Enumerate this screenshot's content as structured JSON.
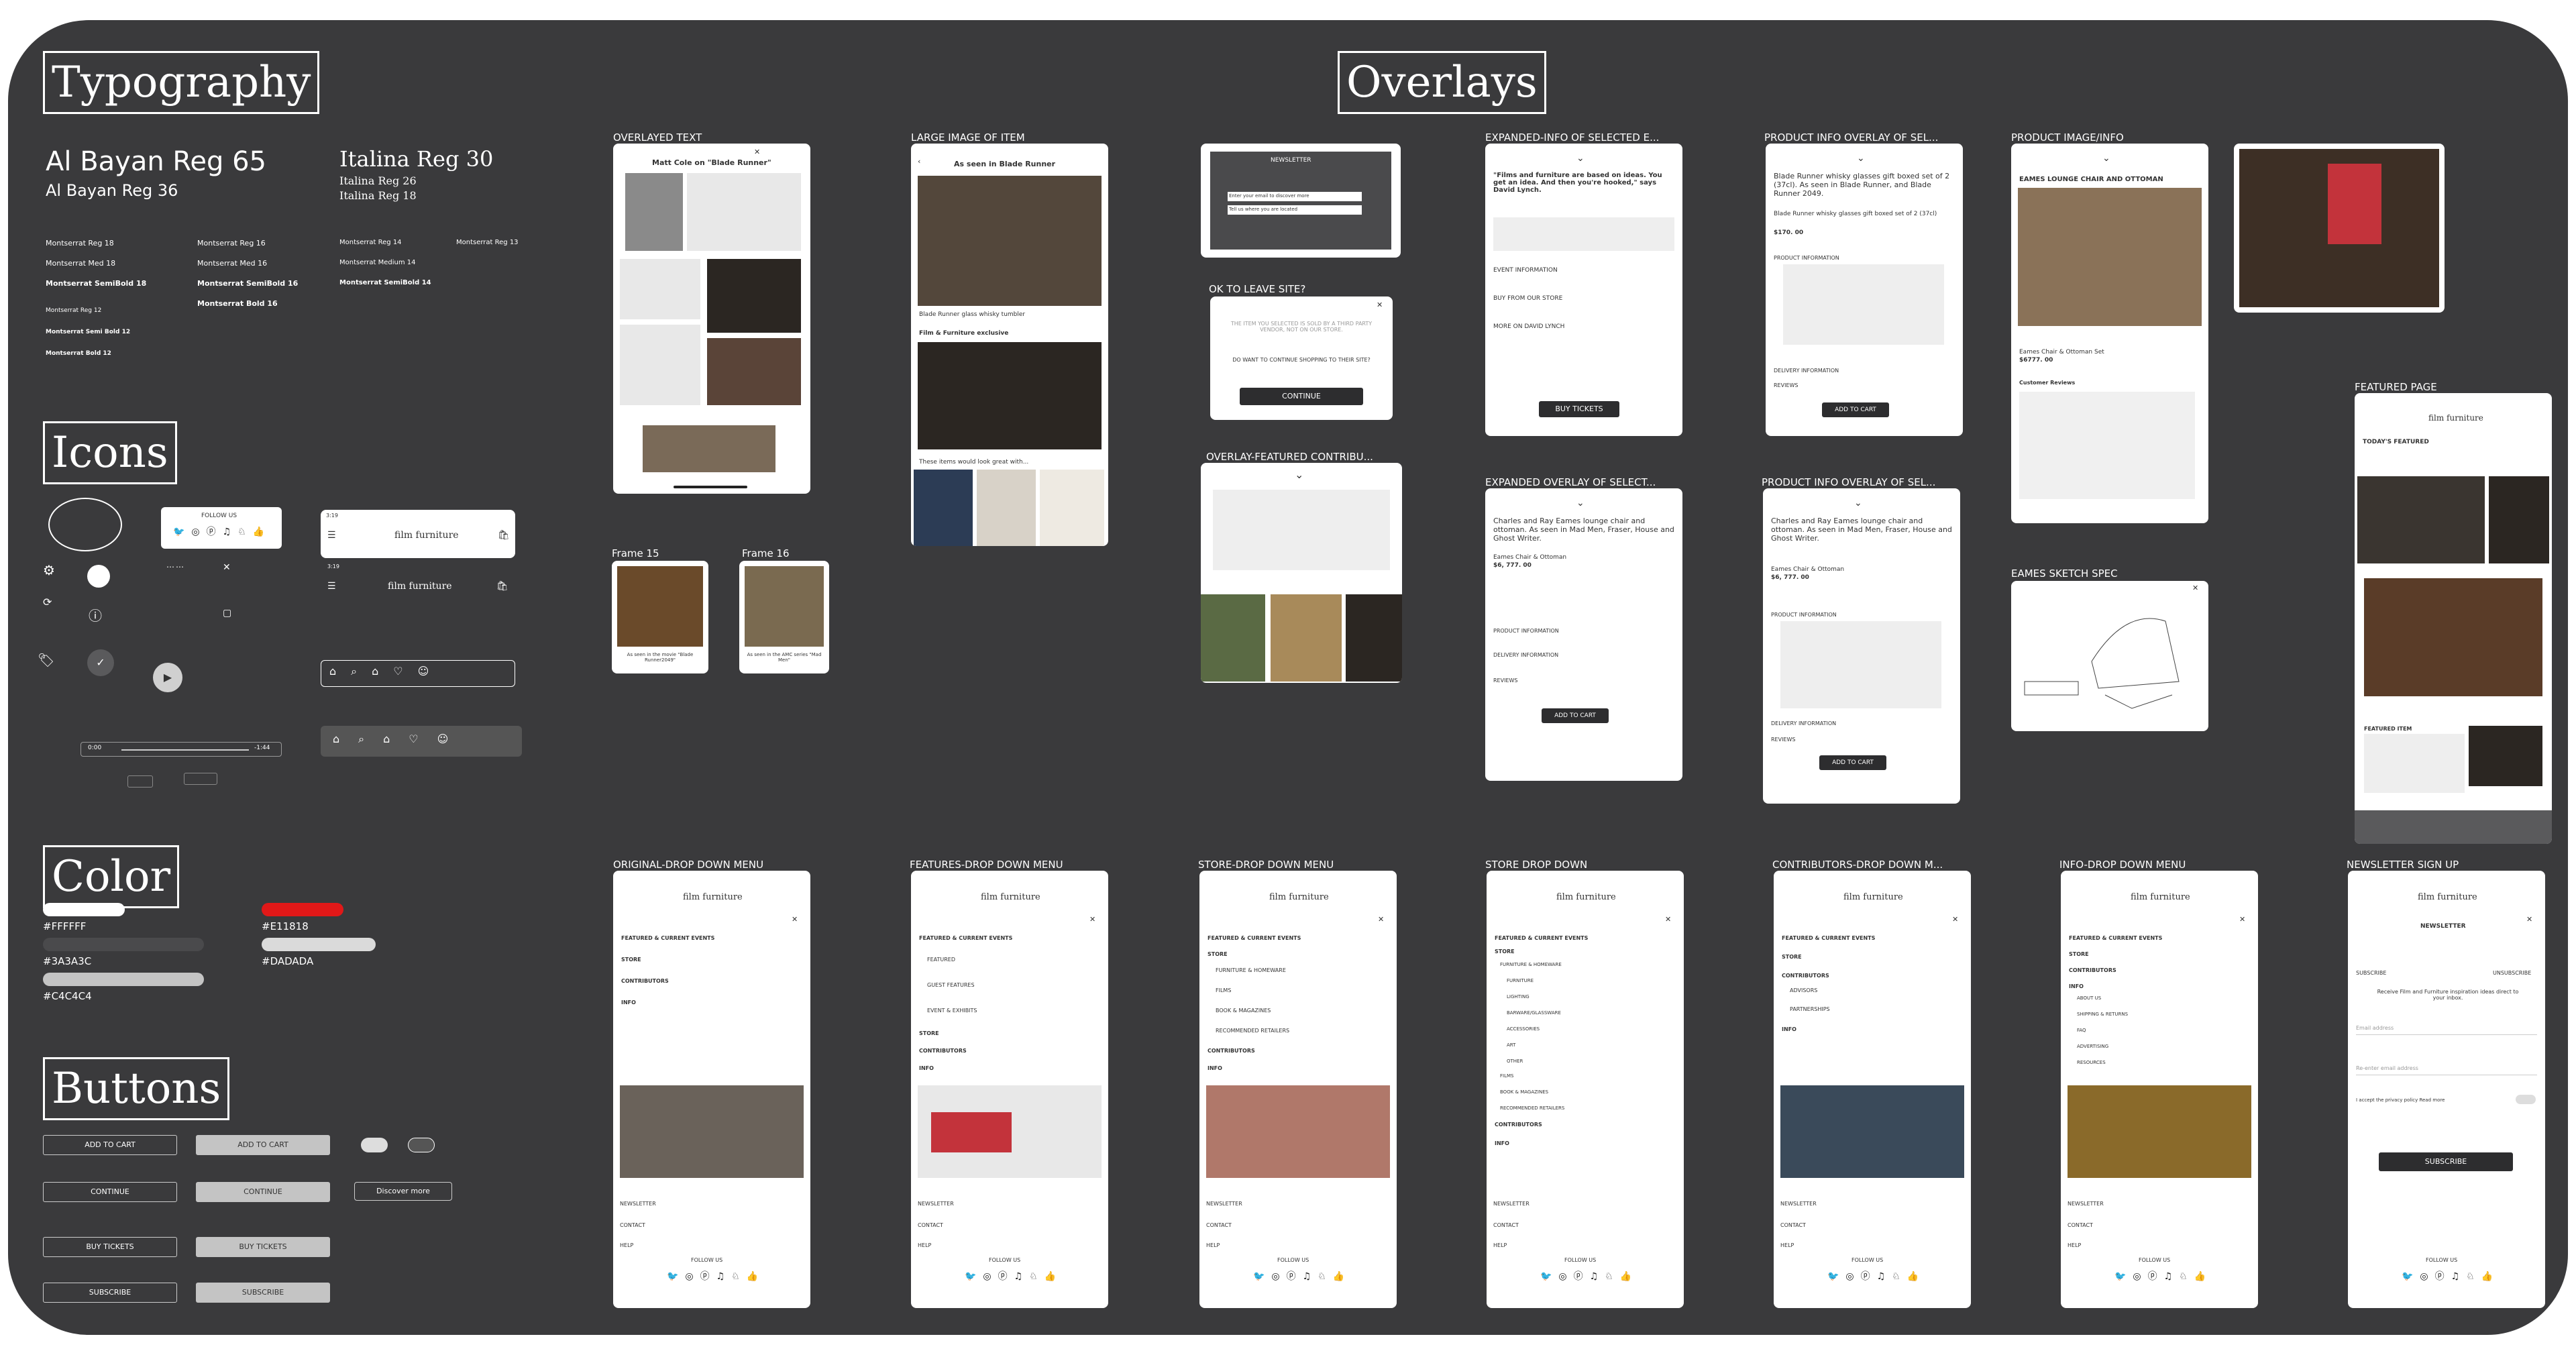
{
  "sections": {
    "typography": "Typography",
    "icons": "Icons",
    "color": "Color",
    "buttons": "Buttons",
    "overlays": "Overlays"
  },
  "typography": {
    "albayan_65": "Al Bayan Reg 65",
    "albayan_36": "Al Bayan Reg 36",
    "italina_30": "Italina Reg 30",
    "italina_26": "Italina Reg 26",
    "italina_18": "Italina Reg 18",
    "col1": [
      "Montserrat Reg 18",
      "Montserrat Med 18",
      "Montserrat SemiBold 18"
    ],
    "col1b": [
      "Montserrat Reg 12",
      "Montserrat Semi Bold 12",
      "Montserrat Bold 12"
    ],
    "col2": [
      "Montserrat Reg 16",
      "Montserrat Med 16",
      "Montserrat SemiBold 16",
      "Montserrat Bold 16"
    ],
    "col3": [
      "Montserrat Reg 14",
      "Montserrat Medium 14",
      "Montserrat SemiBold 14"
    ],
    "col4": "Montserrat Reg 13"
  },
  "colors": {
    "white": "#FFFFFF",
    "dark": "#3A3A3C",
    "light": "#C4C4C4",
    "red": "#E11818",
    "gray": "#DADADA"
  },
  "buttons": {
    "add_to_cart": "ADD TO CART",
    "continue": "CONTINUE",
    "buy_tickets": "BUY TICKETS",
    "subscribe": "SUBSCRIBE",
    "discover_more": "Discover more"
  },
  "icons": {
    "follow_us": "FOLLOW US",
    "logo": "film furniture",
    "time": "3:19",
    "video_time": "0:00",
    "video_end": "-1:44"
  },
  "overlays": {
    "overlayed_text": {
      "label": "OVERLAYED TEXT",
      "heading": "Matt Cole on \"Blade Runner\""
    },
    "large_image": {
      "label": "LARGE IMAGE OF ITEM",
      "heading": "As seen in  Blade Runner",
      "caption": "Blade Runner glass whisky tumbler",
      "sub": "Film & Furniture exclusive",
      "more": "These items would look great with..."
    },
    "frame15": {
      "label": "Frame 15",
      "caption": "As seen in the movie \"Blade Runner2049\""
    },
    "frame16": {
      "label": "Frame 16",
      "caption": "As seen in the AMC series \"Mad Men\""
    },
    "newsletter_popup": {
      "title": "NEWSLETTER",
      "email": "Enter your email to discover more",
      "tell": "Tell us where you are located"
    },
    "ok_to_leave": {
      "label": "OK TO LEAVE SITE?",
      "body": "THE ITEM YOU SELECTED IS SOLD BY A THIRD PARTY VENDOR, NOT ON OUR STORE.",
      "question": "DO WANT TO CONTINUE SHOPPING TO THEIR SITE?",
      "button": "CONTINUE"
    },
    "featured_contrib": {
      "label": "OVERLAY-FEATURED CONTRIBU..."
    },
    "expanded_info": {
      "label": "EXPANDED-INFO OF SELECTED E...",
      "quote": "\"Films and furniture are based on ideas. You get an idea. And then you're hooked,\" says David Lynch.",
      "items": [
        "EVENT INFORMATION",
        "BUY FROM OUR STORE",
        "MORE ON DAVID LYNCH"
      ],
      "button": "BUY TICKETS"
    },
    "expanded_overlay": {
      "label": "EXPANDED OVERLAY OF SELECT...",
      "title": "Charles and Ray Eames lounge chair and ottoman. As seen in Mad Men, Fraser, House and Ghost Writer.",
      "name": "Eames Chair & Ottoman",
      "price": "$6, 777. 00",
      "items": [
        "PRODUCT INFORMATION",
        "DELIVERY INFORMATION",
        "REVIEWS"
      ],
      "button": "ADD TO CART"
    },
    "product_info1": {
      "label": "PRODUCT INFO OVERLAY OF SEL...",
      "title": "Blade Runner whisky glasses gift boxed set of 2 (37cl). As seen in Blade Runner, and Blade Runner 2049.",
      "name": "Blade Runner whisky glasses gift boxed set of 2 (37cl)",
      "price": "$170. 00",
      "items": [
        "PRODUCT INFORMATION",
        "DELIVERY INFORMATION",
        "REVIEWS"
      ],
      "button": "ADD TO CART"
    },
    "product_info2": {
      "label": "PRODUCT INFO OVERLAY OF SEL...",
      "title": "Charles and Ray Eames lounge chair and ottoman. As seen in Mad Men, Fraser, House and Ghost Writer.",
      "name": "Eames Chair & Ottoman",
      "price": "$6, 777. 00",
      "items": [
        "PRODUCT INFORMATION",
        "DELIVERY INFORMATION",
        "REVIEWS"
      ],
      "button": "ADD TO CART"
    },
    "product_image": {
      "label": "PRODUCT IMAGE/INFO",
      "title": "EAMES LOUNGE CHAIR AND OTTOMAN",
      "name": "Eames Chair & Ottoman Set",
      "price": "$6777. 00",
      "reviews": "Customer Reviews"
    },
    "eames_sketch": {
      "label": "EAMES SKETCH SPEC"
    },
    "featured_page": {
      "label": "FEATURED PAGE",
      "today": "TODAY'S FEATURED",
      "item": "FEATURED ITEM"
    }
  },
  "menus": [
    {
      "label": "ORIGINAL-DROP DOWN MENU",
      "items": [
        "FEATURED & CURRENT EVENTS",
        "STORE",
        "CONTRIBUTORS",
        "INFO"
      ]
    },
    {
      "label": "FEATURES-DROP DOWN MENU",
      "items": [
        "FEATURED & CURRENT EVENTS",
        "FEATURED",
        "GUEST FEATURES",
        "EVENT & EXHIBITS",
        "STORE",
        "CONTRIBUTORS",
        "INFO"
      ]
    },
    {
      "label": "STORE-DROP DOWN MENU",
      "items": [
        "FEATURED & CURRENT EVENTS",
        "STORE",
        "FURNITURE & HOMEWARE",
        "FILMS",
        "BOOK & MAGAZINES",
        "RECOMMENDED RETAILERS",
        "CONTRIBUTORS",
        "INFO"
      ]
    },
    {
      "label": "STORE DROP DOWN",
      "items": [
        "FEATURED & CURRENT EVENTS",
        "STORE",
        "FURNITURE & HOMEWARE",
        "FURNITURE",
        "LIGHTING",
        "BARWARE/GLASSWARE",
        "ACCESSORIES",
        "ART",
        "OTHER",
        "FILMS",
        "BOOK & MAGAZINES",
        "RECOMMENDED RETAILERS",
        "CONTRIBUTORS",
        "INFO"
      ]
    },
    {
      "label": "CONTRIBUTORS-DROP DOWN M...",
      "items": [
        "FEATURED & CURRENT EVENTS",
        "STORE",
        "CONTRIBUTORS",
        "ADVISORS",
        "PARTNERSHIPS",
        "INFO"
      ]
    },
    {
      "label": "INFO-DROP DOWN MENU",
      "items": [
        "FEATURED & CURRENT EVENTS",
        "STORE",
        "CONTRIBUTORS",
        "INFO",
        "ABOUT US",
        "SHIPPING & RETURNS",
        "FAQ",
        "ADVERTISING",
        "RESOURCES"
      ]
    }
  ],
  "footer": {
    "newsletter": "NEWSLETTER",
    "contact": "CONTACT",
    "help": "HELP",
    "follow": "FOLLOW US"
  },
  "newsletter_signup": {
    "label": "NEWSLETTER SIGN UP",
    "title": "NEWSLETTER",
    "subscribe": "SUBSCRIBE",
    "unsubscribe": "UNSUBSCRIBE",
    "desc": "Receive Film and Furniture inspiration ideas direct to your inbox.",
    "email": "Email address",
    "reenter": "Re-enter email address",
    "policy": "I accept the privacy policy Read more",
    "button": "SUBSCRIBE"
  }
}
